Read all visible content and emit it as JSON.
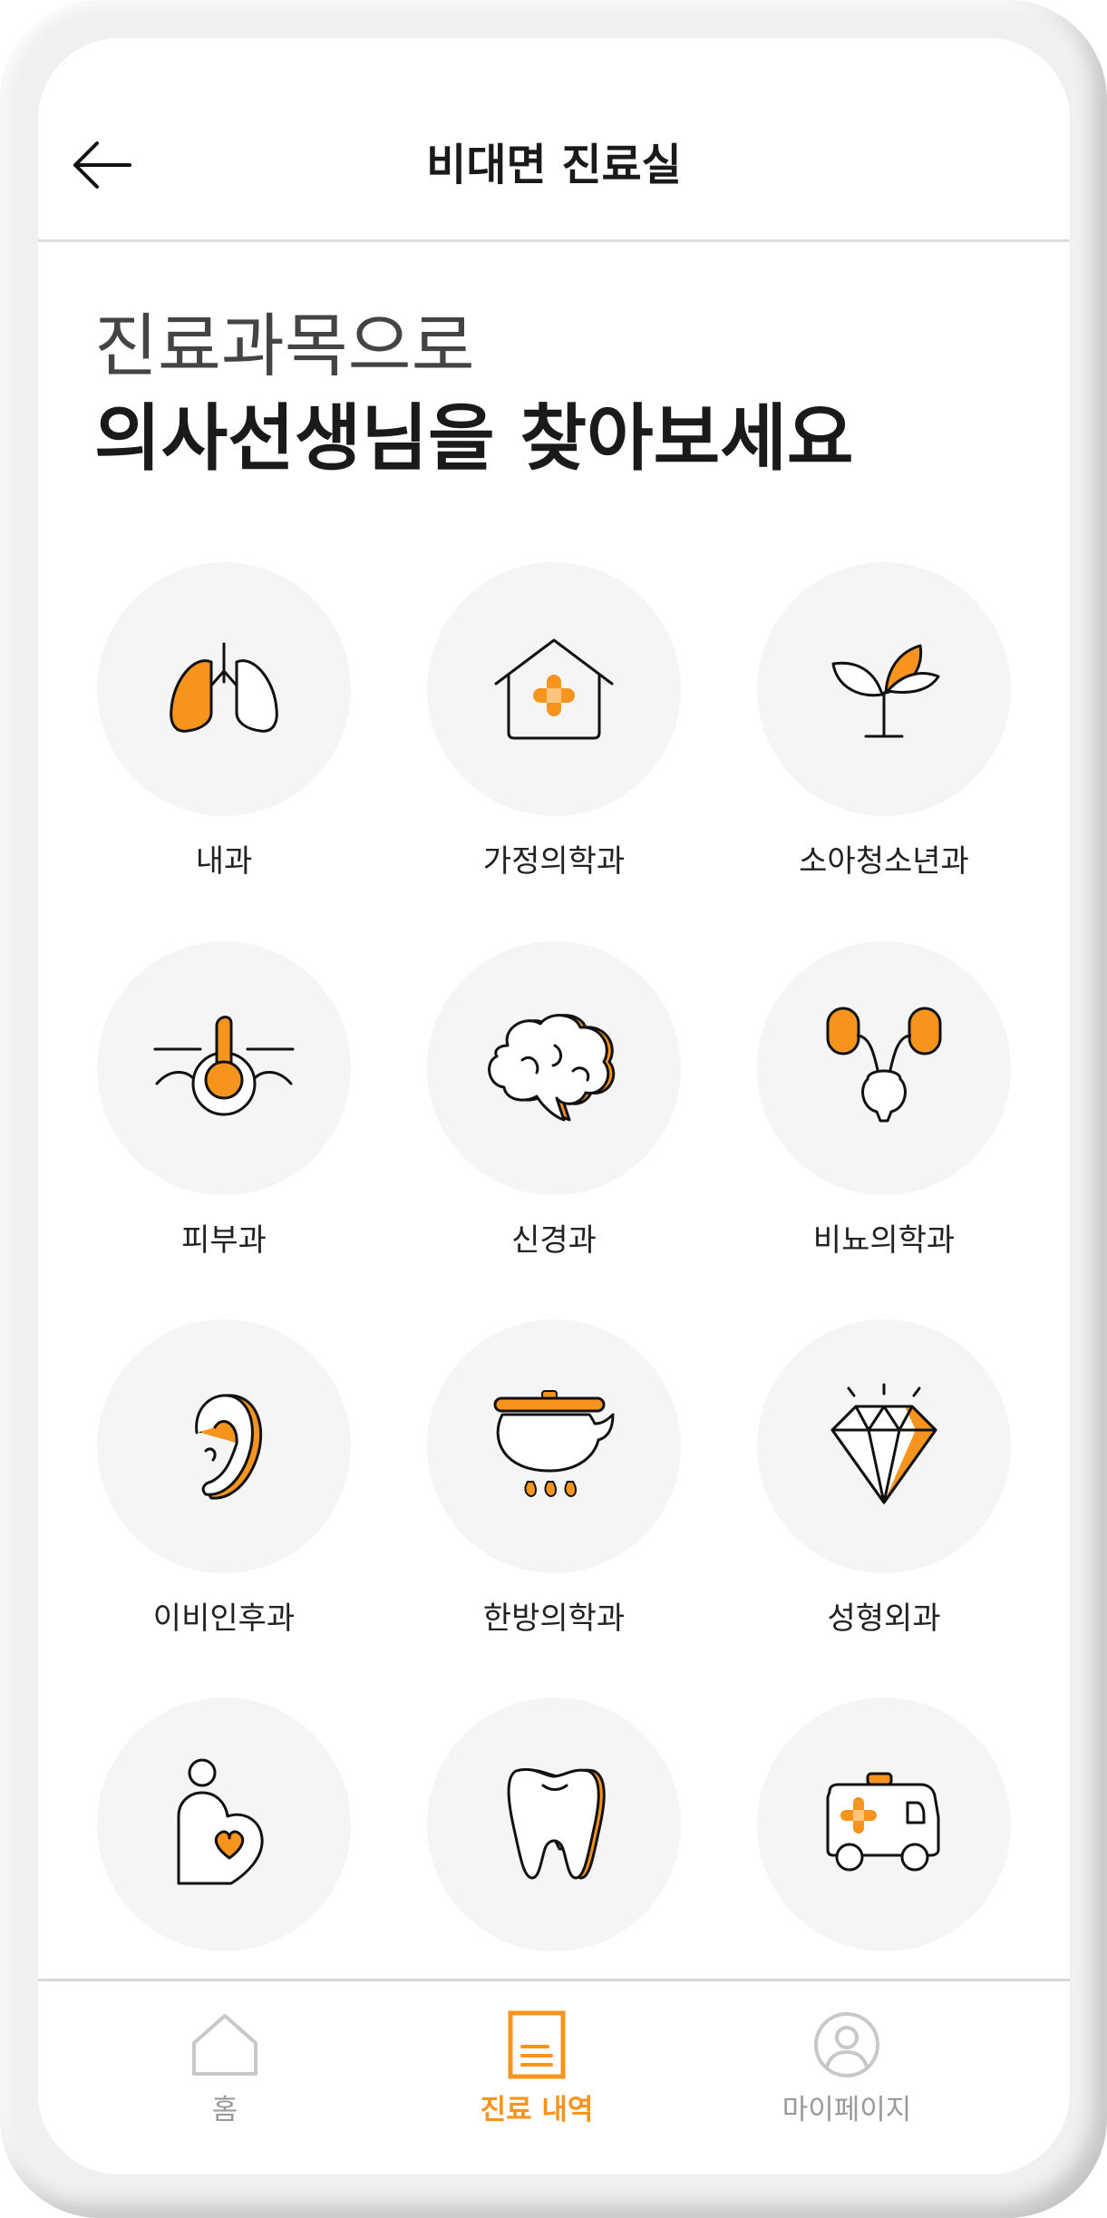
{
  "header": {
    "title": "비대면 진료실"
  },
  "heading": {
    "line1": "진료과목으로",
    "line2": "의사선생님을 찾아보세요"
  },
  "departments": [
    {
      "label": "내과",
      "icon": "lungs-icon"
    },
    {
      "label": "가정의학과",
      "icon": "house-cross-icon"
    },
    {
      "label": "소아청소년과",
      "icon": "sprout-icon"
    },
    {
      "label": "피부과",
      "icon": "hair-follicle-icon"
    },
    {
      "label": "신경과",
      "icon": "brain-icon"
    },
    {
      "label": "비뇨의학과",
      "icon": "kidneys-icon"
    },
    {
      "label": "이비인후과",
      "icon": "ear-icon"
    },
    {
      "label": "한방의학과",
      "icon": "herbal-pot-icon"
    },
    {
      "label": "성형외과",
      "icon": "diamond-icon"
    },
    {
      "label": "",
      "icon": "pregnancy-icon"
    },
    {
      "label": "",
      "icon": "tooth-icon"
    },
    {
      "label": "",
      "icon": "ambulance-icon"
    }
  ],
  "nav": {
    "home": "홈",
    "history": "진료 내역",
    "mypage": "마이페이지"
  },
  "colors": {
    "accent": "#F7941D",
    "text": "#1a1a1a",
    "inactive": "#aaaaaa"
  }
}
